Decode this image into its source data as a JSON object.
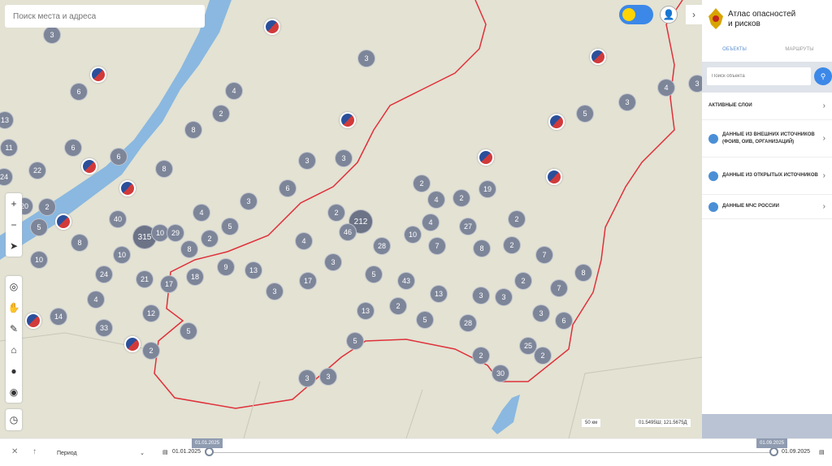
{
  "map": {
    "search_placeholder": "Поиск места и адреса",
    "clusters": [
      3,
      3,
      6,
      4,
      2,
      3,
      5,
      13,
      8,
      11,
      6,
      6,
      3,
      3,
      8,
      22,
      24,
      2,
      6,
      4,
      2,
      19,
      3,
      2,
      20,
      4,
      2,
      212,
      4,
      27,
      2,
      40,
      5,
      5,
      315,
      10,
      29,
      46,
      2,
      4,
      10,
      28,
      8,
      7,
      8,
      2,
      8,
      10,
      10,
      7,
      3,
      9,
      13,
      24,
      5,
      8,
      21,
      18,
      17,
      17,
      43,
      2,
      3,
      7,
      13,
      3,
      3,
      4,
      2,
      13,
      12,
      14,
      3,
      5,
      6,
      28,
      33,
      5,
      5,
      25,
      2,
      2,
      2,
      30,
      3,
      3,
      3,
      4
    ],
    "photo_markers": 12,
    "controls": {
      "zoom_in": "+",
      "zoom_out": "−"
    },
    "scale": "50 км",
    "coords": "01.5495Ш; 121.5675Д",
    "colors": {
      "border": "#e0303a",
      "water": "#8ab8e0",
      "cluster": "#7d8599",
      "accent": "#3b88e8"
    }
  },
  "panel": {
    "title_line1": "Атлас опасностей",
    "title_line2": "и рисков",
    "tabs": [
      "Объекты",
      "Маршруты"
    ],
    "search_placeholder": "Поиск объекта",
    "rows": [
      {
        "label": "Активные слои",
        "icon": false
      },
      {
        "label": "Данные из внешних источников (ФОИВ, ОИВ, организаций)",
        "icon": true
      },
      {
        "label": "Данные из открытых источников",
        "icon": true
      },
      {
        "label": "Данные МЧС России",
        "icon": true
      }
    ]
  },
  "timeline": {
    "period_label": "Период",
    "start_date": "01.01.2025",
    "end_date": "01.09.2025",
    "start_tip": "01.01.2025",
    "end_tip": "01.09.2025"
  }
}
